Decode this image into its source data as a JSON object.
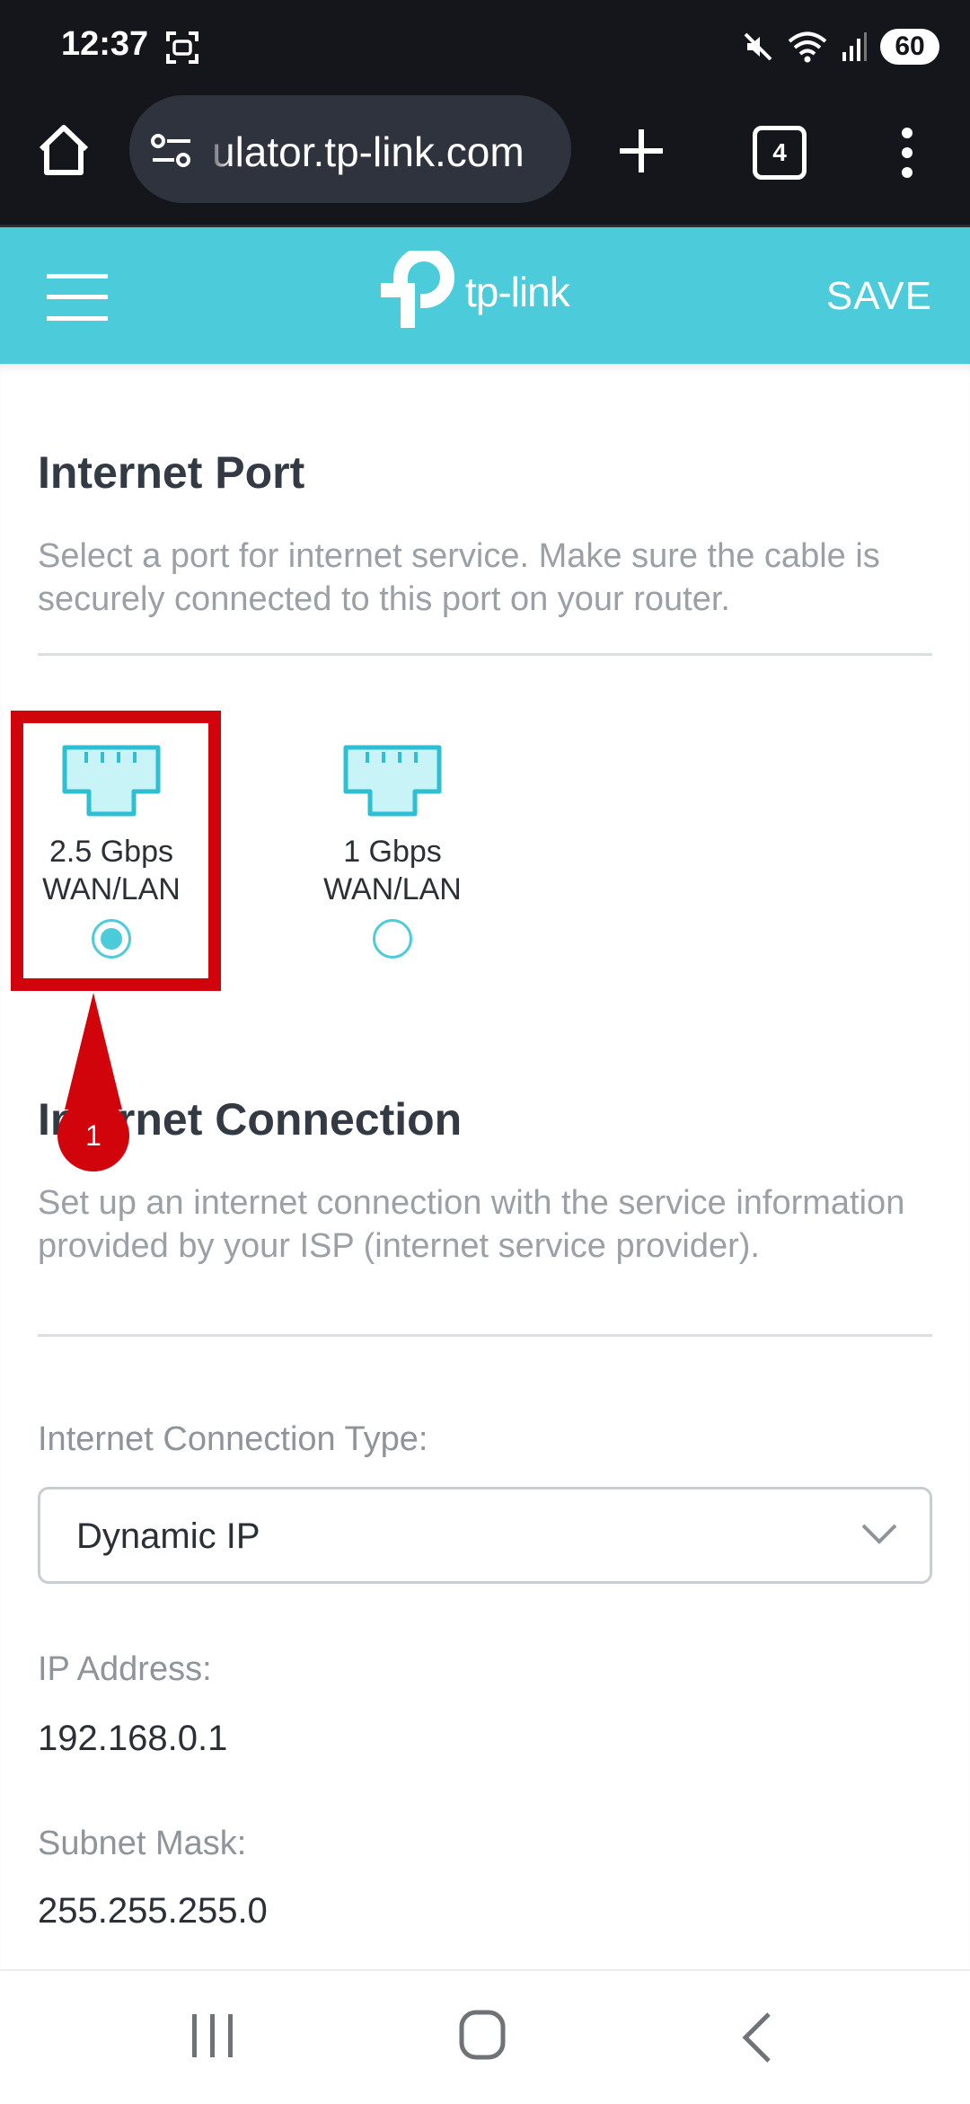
{
  "status_bar": {
    "time": "12:37",
    "battery": "60",
    "icons": [
      "screenshot-icon",
      "mute-icon",
      "wifi-icon",
      "signal-icon",
      "battery-icon"
    ]
  },
  "browser": {
    "url": "ulator.tp-link.com",
    "tab_count": "4",
    "icons": [
      "home-icon",
      "site-settings-icon",
      "plus-icon",
      "more-vertical-icon"
    ]
  },
  "header": {
    "brand": "tp-link",
    "save_label": "SAVE",
    "accent_color": "#4ccbda"
  },
  "internet_port": {
    "title": "Internet Port",
    "description": "Select a port for internet service. Make sure the cable is securely connected to this port on your router.",
    "ports": [
      {
        "line1": "2.5 Gbps",
        "line2": "WAN/LAN",
        "selected": true
      },
      {
        "line1": "1 Gbps",
        "line2": "WAN/LAN",
        "selected": false
      }
    ]
  },
  "annotation": {
    "step": "1",
    "color": "#d0040a"
  },
  "internet_connection": {
    "title": "Internet Connection",
    "description": "Set up an internet connection with the service information provided by your ISP (internet service provider).",
    "type_label": "Internet Connection Type:",
    "type_value": "Dynamic IP",
    "ip_label": "IP Address:",
    "ip_value": "192.168.0.1",
    "mask_label": "Subnet Mask:",
    "mask_value": "255.255.255.0"
  }
}
